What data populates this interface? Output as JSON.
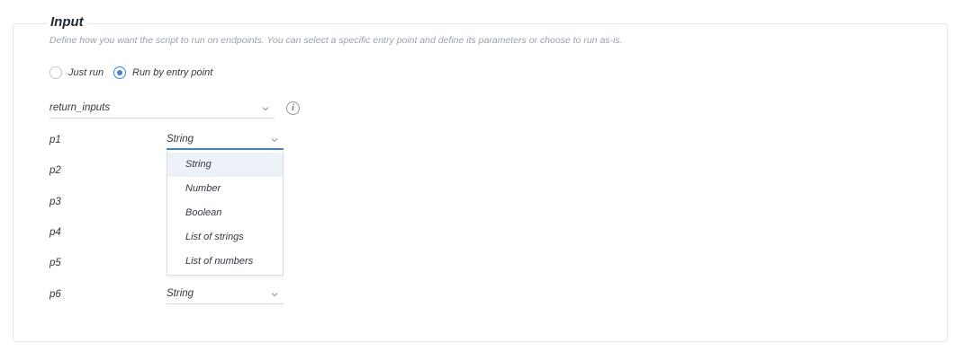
{
  "section": {
    "title": "Input",
    "description": "Define how you want the script to run on endpoints. You can select a specific entry point and define its parameters or choose to run as-is."
  },
  "run_mode": {
    "options": [
      {
        "label": "Just run",
        "checked": false
      },
      {
        "label": "Run by entry point",
        "checked": true
      }
    ]
  },
  "entry_point": {
    "value": "return_inputs",
    "info_icon": "info-icon"
  },
  "parameters": [
    {
      "name": "p1",
      "type": "String"
    },
    {
      "name": "p2"
    },
    {
      "name": "p3"
    },
    {
      "name": "p4"
    },
    {
      "name": "p5"
    },
    {
      "name": "p6",
      "type": "String"
    }
  ],
  "type_dropdown": {
    "options": [
      "String",
      "Number",
      "Boolean",
      "List of strings",
      "List of numbers"
    ],
    "selected": "String"
  },
  "colors": {
    "accent": "#3b82e0",
    "border": "#e3e6ea",
    "muted_text": "#9aa1a9",
    "selected_option_bg": "#edf2f8"
  }
}
